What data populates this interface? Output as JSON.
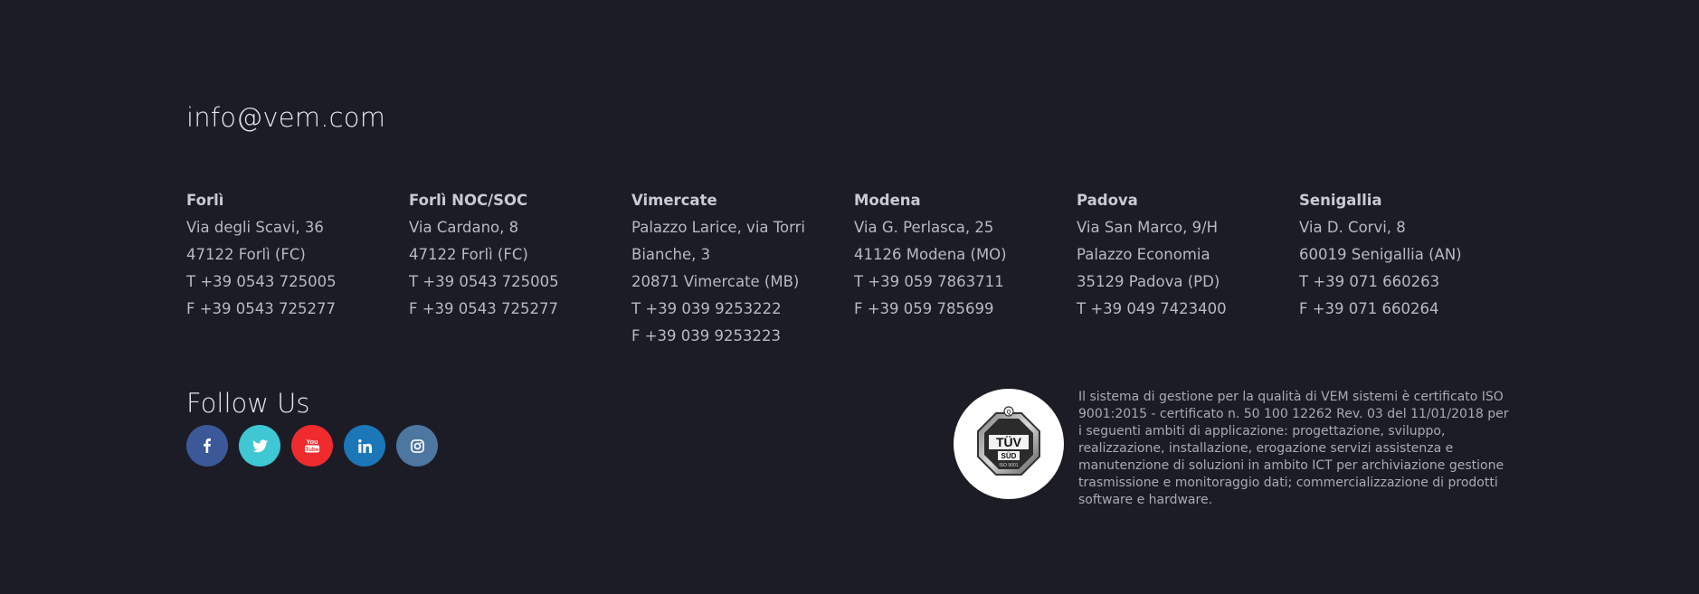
{
  "contact": {
    "email": "info@vem.com"
  },
  "offices": [
    {
      "name": "Forlì",
      "lines": [
        "Via degli Scavi, 36",
        "47122 Forlì (FC)",
        "T +39 0543 725005",
        "F +39 0543 725277"
      ]
    },
    {
      "name": "Forlì NOC/SOC",
      "lines": [
        "Via Cardano, 8",
        "47122 Forlì (FC)",
        "T +39 0543 725005",
        "F +39 0543 725277"
      ]
    },
    {
      "name": "Vimercate",
      "lines": [
        "Palazzo Larice, via Torri",
        "Bianche, 3",
        "20871 Vimercate (MB)",
        "T +39 039 9253222",
        "F +39 039 9253223"
      ]
    },
    {
      "name": "Modena",
      "lines": [
        "Via G. Perlasca, 25",
        "41126 Modena (MO)",
        "T +39 059 7863711",
        "F +39 059 785699"
      ]
    },
    {
      "name": "Padova",
      "lines": [
        "Via San Marco, 9/H",
        "Palazzo Economia",
        "35129 Padova (PD)",
        "T +39 049 7423400"
      ]
    },
    {
      "name": "Senigallia",
      "lines": [
        "Via D. Corvi, 8",
        "60019 Senigallia (AN)",
        "T +39 071 660263",
        "F +39 071 660264"
      ]
    }
  ],
  "follow": {
    "title": "Follow Us",
    "socials": [
      {
        "name": "facebook",
        "icon": "facebook-icon",
        "color": "#3b5998"
      },
      {
        "name": "twitter",
        "icon": "twitter-icon",
        "color": "#3fc7d3"
      },
      {
        "name": "youtube",
        "icon": "youtube-icon",
        "color": "#ef2b2e"
      },
      {
        "name": "linkedin",
        "icon": "linkedin-icon",
        "color": "#1b77b7"
      },
      {
        "name": "instagram",
        "icon": "instagram-icon",
        "color": "#4d76a1"
      }
    ]
  },
  "certification": {
    "badge_main": "TÜV",
    "badge_sub": "SÜD",
    "badge_small": "ISO 9001",
    "badge_top": "Q",
    "text": "Il sistema di gestione per la qualità di VEM sistemi è certificato ISO 9001:2015 - certificato n. 50 100 12262 Rev. 03 del 11/01/2018 per i seguenti ambiti di applicazione: progettazione, sviluppo, realizzazione, installazione, erogazione servizi assistenza e manutenzione di soluzioni in ambito ICT per archiviazione gestione trasmissione e monitoraggio dati; commercializzazione di prodotti software e hardware."
  },
  "colors": {
    "background": "#1b1c25",
    "heading": "#e6e7ea",
    "body_text": "#b8bac1"
  }
}
